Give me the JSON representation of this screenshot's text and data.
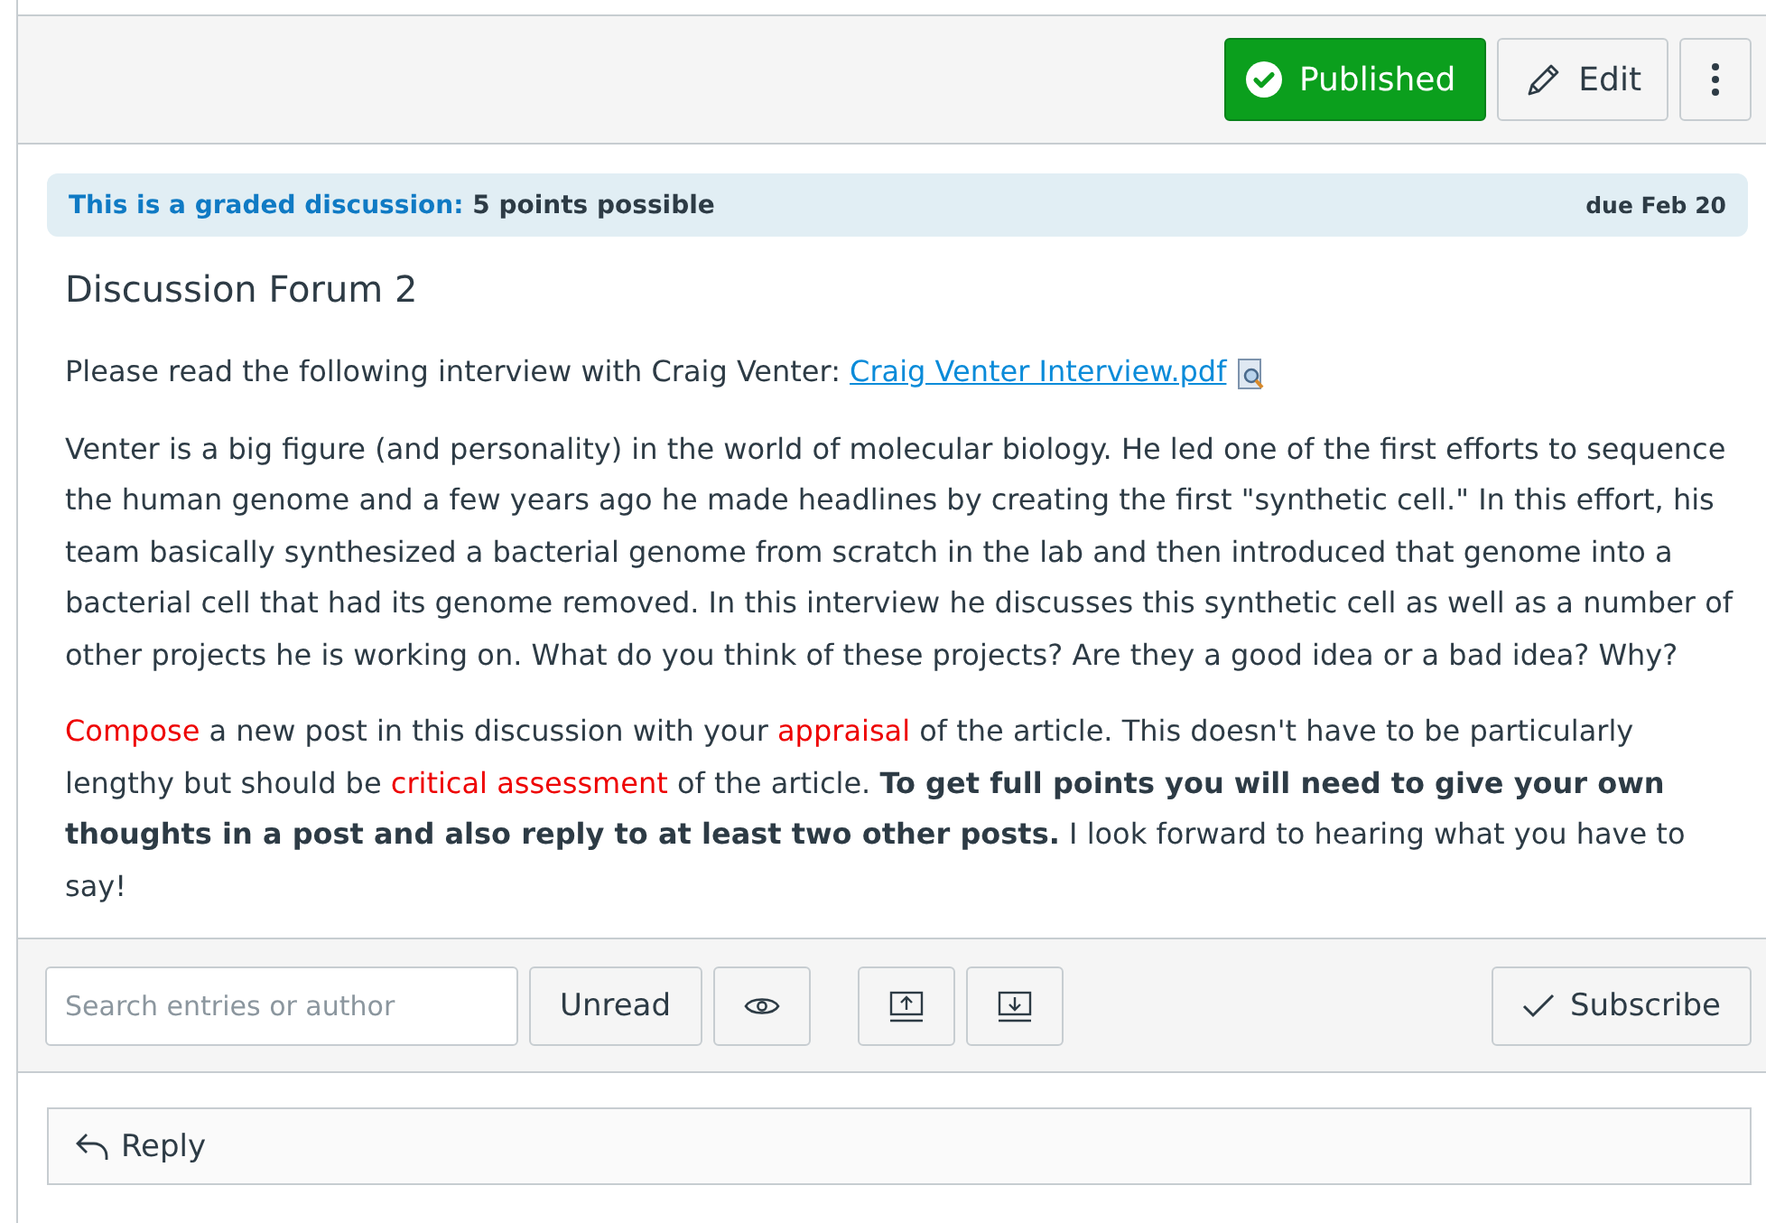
{
  "header": {
    "published_button": {
      "label": "Published",
      "published": true
    },
    "edit_button": "Edit"
  },
  "banner": {
    "lead": "This is a graded discussion:",
    "points": "5 points possible",
    "due": "due Feb 20"
  },
  "title": "Discussion Forum 2",
  "intro": {
    "text": "Please read the following interview with Craig Venter: ",
    "link": "Craig Venter Interview.pdf"
  },
  "paragraph": "Venter is a big figure (and personality) in the world of molecular biology.  He led one of the first efforts to sequence the human genome and a few years ago he made headlines by creating the first \"synthetic cell.\"  In this effort, his team basically synthesized a bacterial genome from scratch in the lab and then introduced that genome into a bacterial cell that had its genome removed.  In this interview he discusses this synthetic cell as well as a number of other projects he is working on.  What do you think of these projects?  Are they a good idea or a bad idea?  Why?",
  "instructions": [
    {
      "kind": "highlight",
      "text": "Compose"
    },
    {
      "kind": "plain",
      "text": " a new post in this discussion with your "
    },
    {
      "kind": "highlight",
      "text": "appraisal"
    },
    {
      "kind": "plain",
      "text": " of the article.  This doesn't have to be particularly lengthy but should be "
    },
    {
      "kind": "highlight",
      "text": "critical assessment"
    },
    {
      "kind": "plain",
      "text": " of the article.  "
    },
    {
      "kind": "bold",
      "text": "To get full points you will need to give your own thoughts in a post and also reply to at least two other posts."
    },
    {
      "kind": "plain",
      "text": "  I look forward to hearing what you have to say!"
    }
  ],
  "toolbar": {
    "search": {
      "placeholder": "Search entries or author"
    },
    "unread_button": "Unread",
    "subscribe_button": {
      "label": "Subscribe",
      "subscribed": false
    }
  },
  "reply_button": "Reply"
}
